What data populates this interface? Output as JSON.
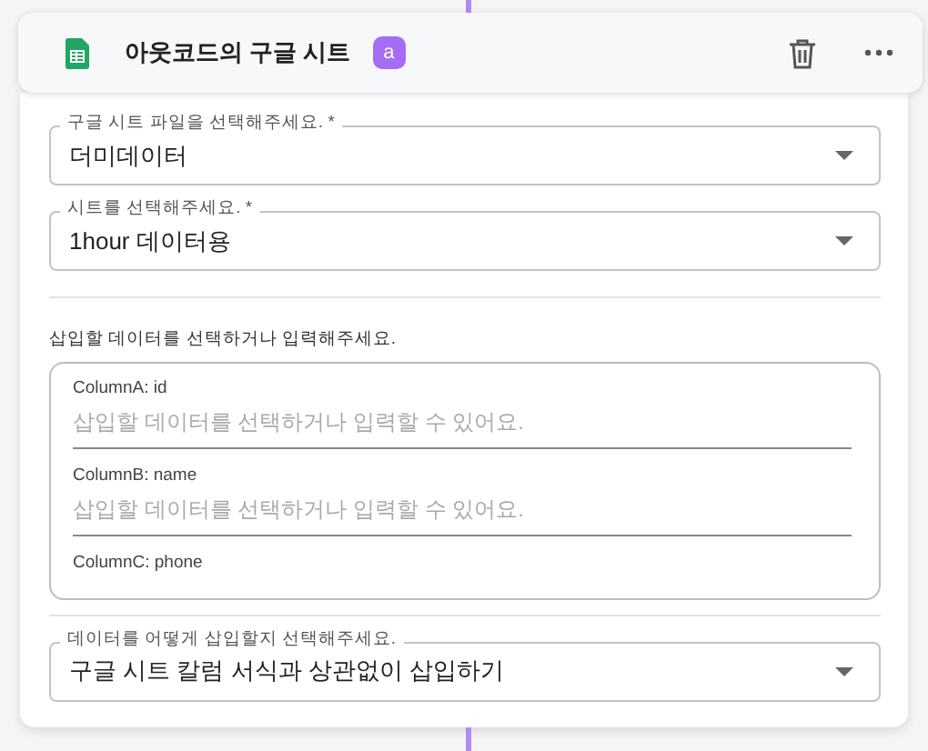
{
  "header": {
    "title": "아웃코드의 구글 시트",
    "badge": "a"
  },
  "selects": [
    {
      "label": "구글 시트 파일을 선택해주세요. *",
      "value": "더미데이터"
    },
    {
      "label": "시트를 선택해주세요. *",
      "value": "1hour 데이터용"
    }
  ],
  "data_section": {
    "label": "삽입할 데이터를 선택하거나 입력해주세요.",
    "columns": [
      {
        "label": "ColumnA: id",
        "placeholder": "삽입할 데이터를 선택하거나 입력할 수 있어요."
      },
      {
        "label": "ColumnB: name",
        "placeholder": "삽입할 데이터를 선택하거나 입력할 수 있어요."
      },
      {
        "label": "ColumnC: phone"
      }
    ]
  },
  "insert_mode": {
    "label": "데이터를 어떻게 삽입할지 선택해주세요.",
    "value": "구글 시트 칼럼 서식과 상관없이 삽입하기"
  }
}
